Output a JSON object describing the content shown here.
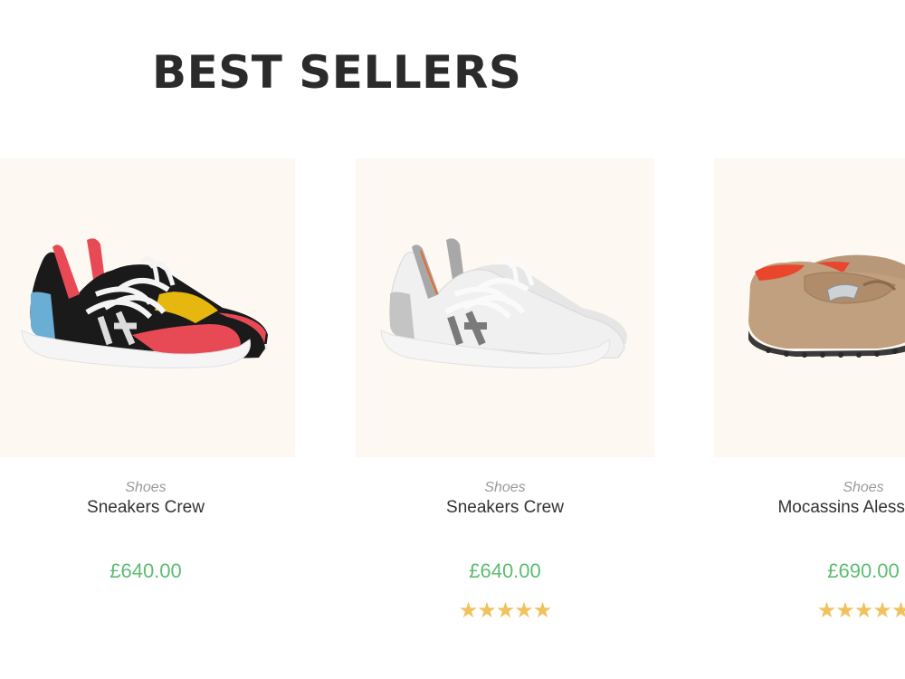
{
  "section": {
    "title": "BEST SELLERS"
  },
  "products": [
    {
      "category": "Shoes",
      "name": "Sneakers Crew",
      "price": "£640.00",
      "rating": null,
      "image": "multicolor-sneaker-image"
    },
    {
      "category": "Shoes",
      "name": "Sneakers Crew",
      "price": "£640.00",
      "rating": 5,
      "image": "white-sneaker-image"
    },
    {
      "category": "Shoes",
      "name": "Mocassins Alessandro",
      "price": "£690.00",
      "rating": 5,
      "image": "tan-moccasin-image"
    }
  ],
  "colors": {
    "title": "#2b2b2b",
    "price": "#5cbd72",
    "star": "#f1c15d",
    "image_bg": "#fdf8f1"
  }
}
